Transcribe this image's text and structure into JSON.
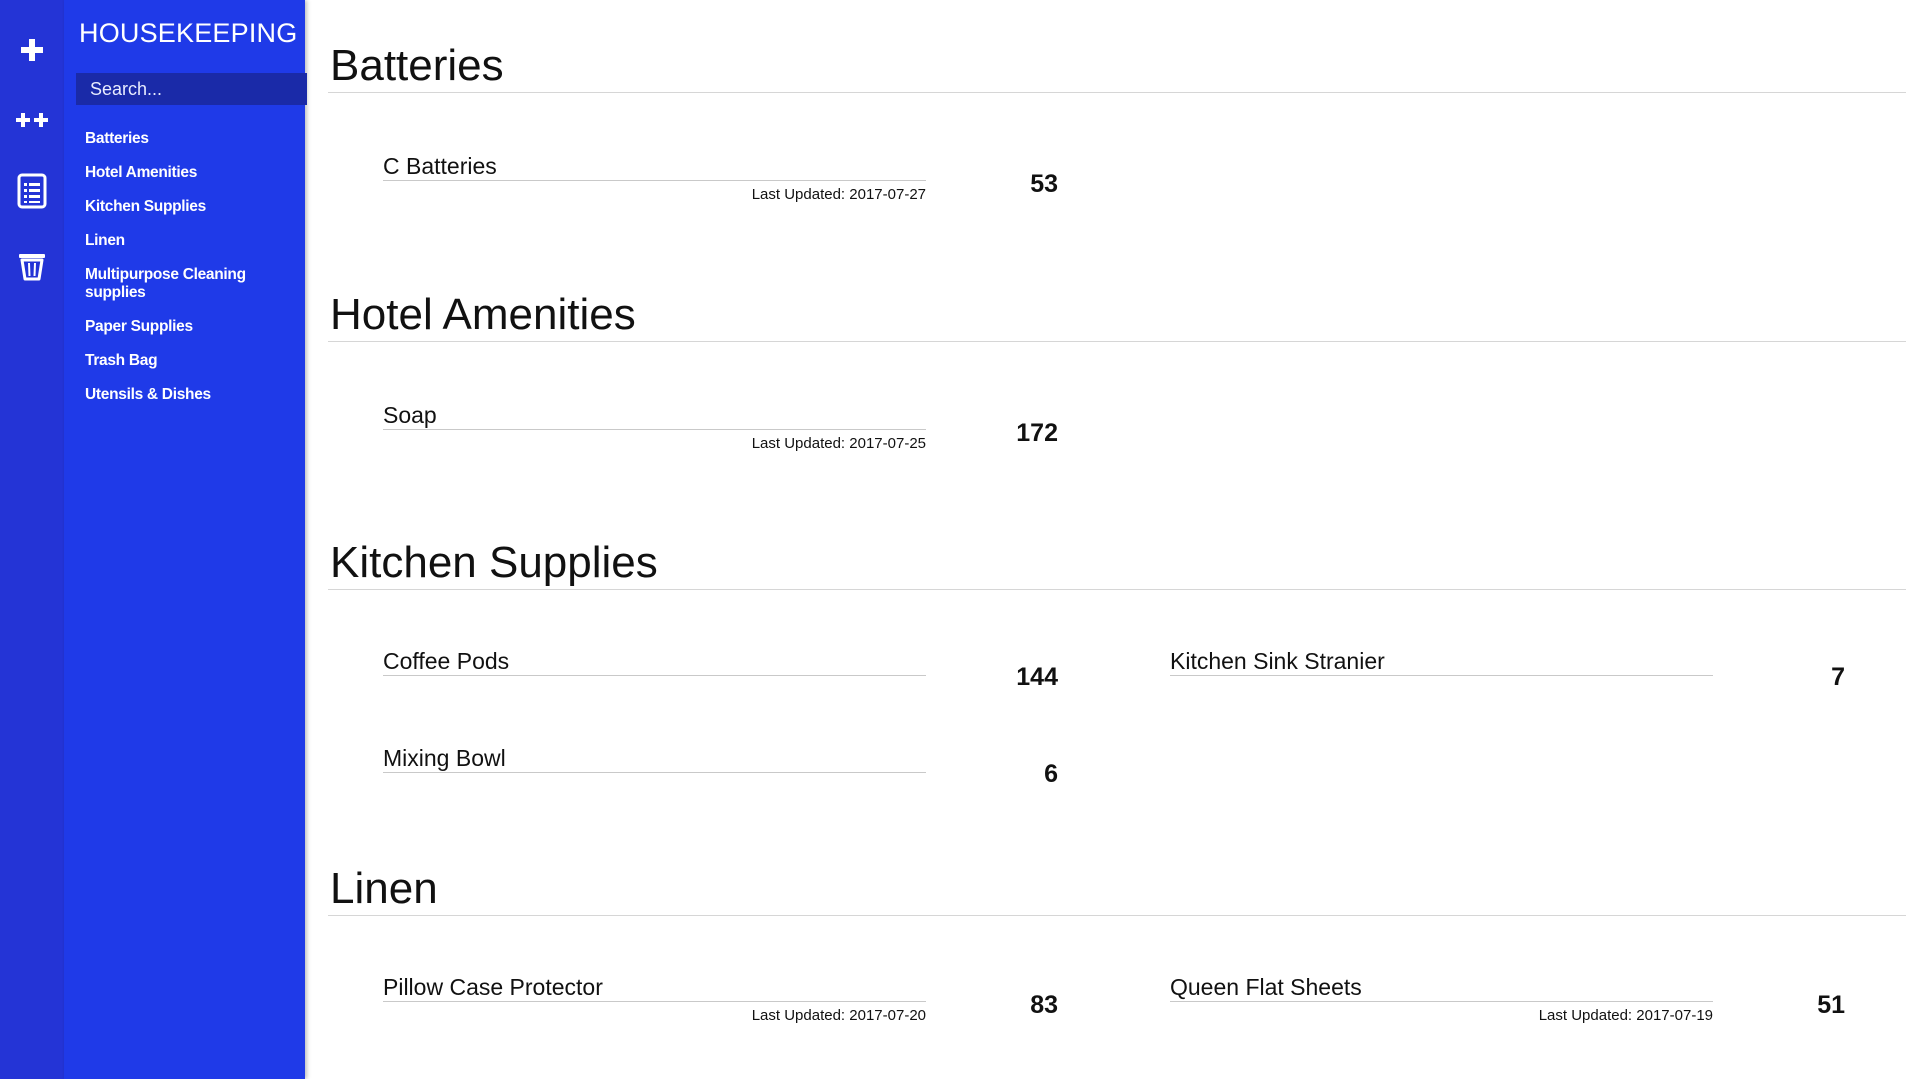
{
  "app": {
    "brand": "HOUSEKEEPING",
    "search_placeholder": "Search...",
    "accent_color": "#1f3ae8",
    "rail_color": "#2434d6"
  },
  "rail": [
    {
      "icon": "plus-icon"
    },
    {
      "icon": "double-plus-icon"
    },
    {
      "icon": "document-list-icon"
    },
    {
      "icon": "trash-icon"
    }
  ],
  "nav": [
    "Batteries",
    "Hotel Amenities",
    "Kitchen Supplies",
    "Linen",
    "Multipurpose Cleaning supplies",
    "Paper Supplies",
    "Trash Bag",
    "Utensils & Dishes"
  ],
  "sections": [
    {
      "title": "Batteries",
      "items": [
        {
          "name": "C Batteries",
          "updated": "Last Updated: 2017-07-27",
          "qty": "53"
        }
      ]
    },
    {
      "title": "Hotel Amenities",
      "items": [
        {
          "name": "Soap",
          "updated": "Last Updated: 2017-07-25",
          "qty": "172"
        }
      ]
    },
    {
      "title": "Kitchen Supplies",
      "items": [
        {
          "name": "Coffee Pods",
          "updated": "",
          "qty": "144"
        },
        {
          "name": "Kitchen Sink Stranier",
          "updated": "",
          "qty": "7"
        },
        {
          "name": "Mixing Bowl",
          "updated": "",
          "qty": "6"
        }
      ]
    },
    {
      "title": "Linen",
      "items": [
        {
          "name": "Pillow Case Protector",
          "updated": "Last Updated: 2017-07-20",
          "qty": "83"
        },
        {
          "name": "Queen Flat Sheets",
          "updated": "Last Updated: 2017-07-19",
          "qty": "51"
        }
      ]
    }
  ]
}
